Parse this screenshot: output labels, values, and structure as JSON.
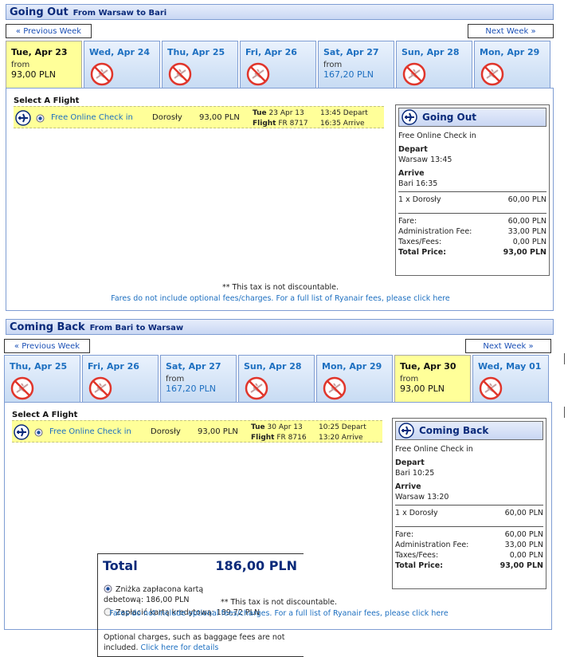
{
  "going_out": {
    "title": "Going Out",
    "route": "From Warsaw to Bari",
    "prev_week": "« Previous Week",
    "next_week": "Next Week »",
    "days": [
      {
        "label": "Tue, Apr 23",
        "from": "from",
        "price": "93,00 PLN",
        "selected": true,
        "available": true
      },
      {
        "label": "Wed, Apr 24",
        "available": false
      },
      {
        "label": "Thu, Apr 25",
        "available": false
      },
      {
        "label": "Fri, Apr 26",
        "available": false
      },
      {
        "label": "Sat, Apr 27",
        "from": "from",
        "price": "167,20 PLN",
        "available": true
      },
      {
        "label": "Sun, Apr 28",
        "available": false
      },
      {
        "label": "Mon, Apr 29",
        "available": false
      }
    ],
    "select_label": "Select A Flight",
    "flight": {
      "checkin": "Free Online Check in",
      "passenger": "Dorosły",
      "price": "93,00 PLN",
      "date_prefix": "Tue",
      "date": "23 Apr 13",
      "flight_prefix": "Flight",
      "flight_no": "FR 8717",
      "depart": "13:45 Depart",
      "arrive": "16:35 Arrive"
    },
    "summary": {
      "title": "Going Out",
      "checkin": "Free Online Check in",
      "depart_label": "Depart",
      "depart_value": "Warsaw 13:45",
      "arrive_label": "Arrive",
      "arrive_value": "Bari 16:35",
      "pax_label": "1 x Dorosły",
      "pax_value": "60,00 PLN",
      "fare_label": "Fare:",
      "fare_value": "60,00 PLN",
      "admin_label": "Administration Fee:",
      "admin_value": "33,00 PLN",
      "taxes_label": "Taxes/Fees:",
      "taxes_value": "0,00 PLN",
      "total_label": "Total Price:",
      "total_value": "93,00 PLN"
    },
    "tax_note": "** This tax is not discountable.",
    "fees_link": "Fares do not include optional fees/charges. For a full list of Ryanair fees, please click here"
  },
  "coming_back": {
    "title": "Coming Back",
    "route": "From Bari to Warsaw",
    "prev_week": "« Previous Week",
    "next_week": "Next Week »",
    "days": [
      {
        "label": "Thu, Apr 25",
        "available": false
      },
      {
        "label": "Fri, Apr 26",
        "available": false
      },
      {
        "label": "Sat, Apr 27",
        "from": "from",
        "price": "167,20 PLN",
        "available": true
      },
      {
        "label": "Sun, Apr 28",
        "available": false
      },
      {
        "label": "Mon, Apr 29",
        "available": false
      },
      {
        "label": "Tue, Apr 30",
        "from": "from",
        "price": "93,00 PLN",
        "selected": true,
        "available": true
      },
      {
        "label": "Wed, May 01",
        "available": false
      }
    ],
    "select_label": "Select A Flight",
    "flight": {
      "checkin": "Free Online Check in",
      "passenger": "Dorosły",
      "price": "93,00 PLN",
      "date_prefix": "Tue",
      "date": "30 Apr 13",
      "flight_prefix": "Flight",
      "flight_no": "FR 8716",
      "depart": "10:25 Depart",
      "arrive": "13:20 Arrive"
    },
    "summary": {
      "title": "Coming Back",
      "checkin": "Free Online Check in",
      "depart_label": "Depart",
      "depart_value": "Bari 10:25",
      "arrive_label": "Arrive",
      "arrive_value": "Warsaw 13:20",
      "pax_label": "1 x Dorosły",
      "pax_value": "60,00 PLN",
      "fare_label": "Fare:",
      "fare_value": "60,00 PLN",
      "admin_label": "Administration Fee:",
      "admin_value": "33,00 PLN",
      "taxes_label": "Taxes/Fees:",
      "taxes_value": "0,00 PLN",
      "total_label": "Total Price:",
      "total_value": "93,00 PLN"
    },
    "tax_note": "** This tax is not discountable.",
    "fees_link": "Fares do not include optional fees/charges. For a full list of Ryanair fees, please click here"
  },
  "total": {
    "label": "Total",
    "amount": "186,00 PLN",
    "option1_line1": "Zniżka zapłacona kartą",
    "option1_line2": "debetową: 186,00 PLN",
    "option2": "Zapłacić kartą kredytową: 189,72 PLN",
    "optional_text": "Optional charges, such as baggage fees are not included.",
    "details_link": "Click here for details"
  },
  "icons": {
    "plane": "plane-icon",
    "no_flight": "no-flight-icon",
    "radio": "radio-icon"
  },
  "colors": {
    "selected_bg": "#ffff99",
    "link": "#1d6fc0",
    "header_text": "#0a2a7a",
    "no_flight_red": "#e0362c"
  }
}
